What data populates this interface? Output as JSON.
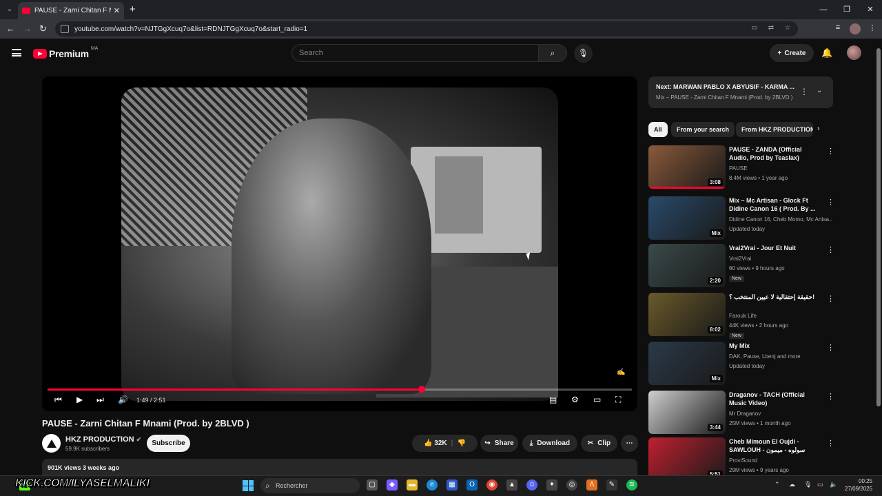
{
  "browser": {
    "tab_title": "PAUSE - Zarni Chitan F Mnami (",
    "url": "youtube.com/watch?v=NJTGgXcuq7o&list=RDNJTGgXcuq7o&start_radio=1"
  },
  "header": {
    "brand": "Premium",
    "country_code": "MA",
    "search_placeholder": "Search",
    "create_label": "Create"
  },
  "player": {
    "time": "1:49 / 2:51",
    "progress": 0.64
  },
  "video": {
    "title": "PAUSE - Zarni Chitan F Mnami (Prod. by 2BLVD )",
    "channel": "HKZ PRODUCTION",
    "subscribers": "59.9K subscribers",
    "subscribe_label": "Subscribe",
    "likes": "32K",
    "share_label": "Share",
    "download_label": "Download",
    "clip_label": "Clip",
    "views_date": "901K views  3 weeks ago"
  },
  "next_up": {
    "title": "Next: MARWAN PABLO X ABYUSIF - KARMA ...",
    "subtitle": "Mix – PAUSE - Zarni Chitan F Mnami (Prod. by 2BLVD )"
  },
  "chips": [
    "All",
    "From your search",
    "From HKZ PRODUCTION"
  ],
  "recommendations": [
    {
      "title": "PAUSE - ZANDA (Official Audio, Prod by Teaslax)",
      "channel": "PAUSE",
      "meta": "8.4M views • 1 year ago",
      "duration": "3:08",
      "badge": "",
      "color": "#8a5a3a"
    },
    {
      "title": "Mix – Mc Artisan - Glock Ft Didine Canon 16 ( Prod. By ...",
      "channel": "Didine Canon 16, Cheb Momo, Mc Artisa...",
      "meta": "Updated today",
      "duration": "Mix",
      "badge": "",
      "color": "#2a4a6a"
    },
    {
      "title": "Vrai2Vrai - Jour Et Nuit",
      "channel": "Vrai2Vrai",
      "meta": "60 views • 9 hours ago",
      "duration": "2:20",
      "badge": "New",
      "color": "#3a4a4a"
    },
    {
      "title": "حقيقة إحتقالية لا عيين المنتخب ؟!",
      "channel": "Farouk Life",
      "meta": "44K views • 2 hours ago",
      "duration": "8:02",
      "badge": "New",
      "color": "#6a5a2a"
    },
    {
      "title": "My Mix",
      "channel": "DAK, Pause, Lbenj and more",
      "meta": "Updated today",
      "duration": "Mix",
      "badge": "",
      "color": "#2a3a4a"
    },
    {
      "title": "Draganov - TACH (Official Music Video)",
      "channel": "Mr Draganov",
      "meta": "25M views • 1 month ago",
      "duration": "3:44",
      "badge": "",
      "color": "#cfcfcf"
    },
    {
      "title": "Cheb Mimoun El Oujdi - SAWLOUH - سولوه - ميمون الوجدي",
      "channel": "ProviSound",
      "meta": "29M views • 9 years ago",
      "duration": "5:51",
      "badge": "",
      "color": "#c02030"
    }
  ],
  "taskbar": {
    "banner": "KICK.COM/ILYASELMALIKI",
    "search_label": "Rechercher",
    "time": "00:25",
    "date": "27/09/2025"
  }
}
